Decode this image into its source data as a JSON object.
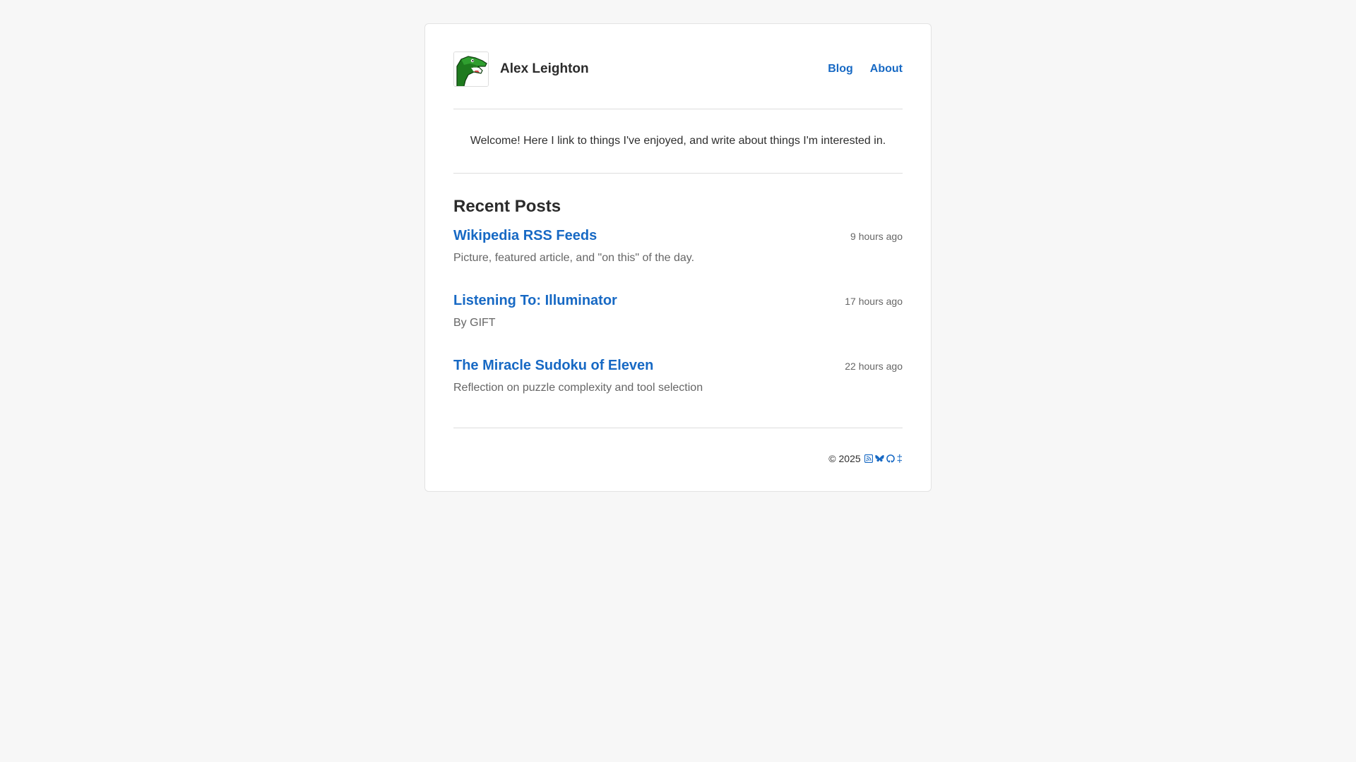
{
  "site": {
    "name": "Alex Leighton",
    "avatar_icon": "green-crocodile-icon"
  },
  "nav": {
    "items": [
      {
        "label": "Blog"
      },
      {
        "label": "About"
      }
    ]
  },
  "welcome": {
    "text": "Welcome! Here I link to things I've enjoyed, and write about things I'm interested in."
  },
  "recent": {
    "heading": "Recent Posts",
    "posts": [
      {
        "title": "Wikipedia RSS Feeds",
        "time": "9 hours ago",
        "description": "Picture, featured article, and \"on this\" of the day."
      },
      {
        "title": "Listening To: Illuminator",
        "time": "17 hours ago",
        "description": "By GIFT"
      },
      {
        "title": "The Miracle Sudoku of Eleven",
        "time": "22 hours ago",
        "description": "Reflection on puzzle complexity and tool selection"
      }
    ]
  },
  "footer": {
    "copyright": "© 2025",
    "icons": [
      "rss-icon",
      "bluesky-icon",
      "github-icon",
      "dagger-icon"
    ],
    "dagger": "‡"
  },
  "colors": {
    "link": "#1769c4",
    "background": "#f7f7f7",
    "card": "#ffffff",
    "muted": "#666666"
  }
}
